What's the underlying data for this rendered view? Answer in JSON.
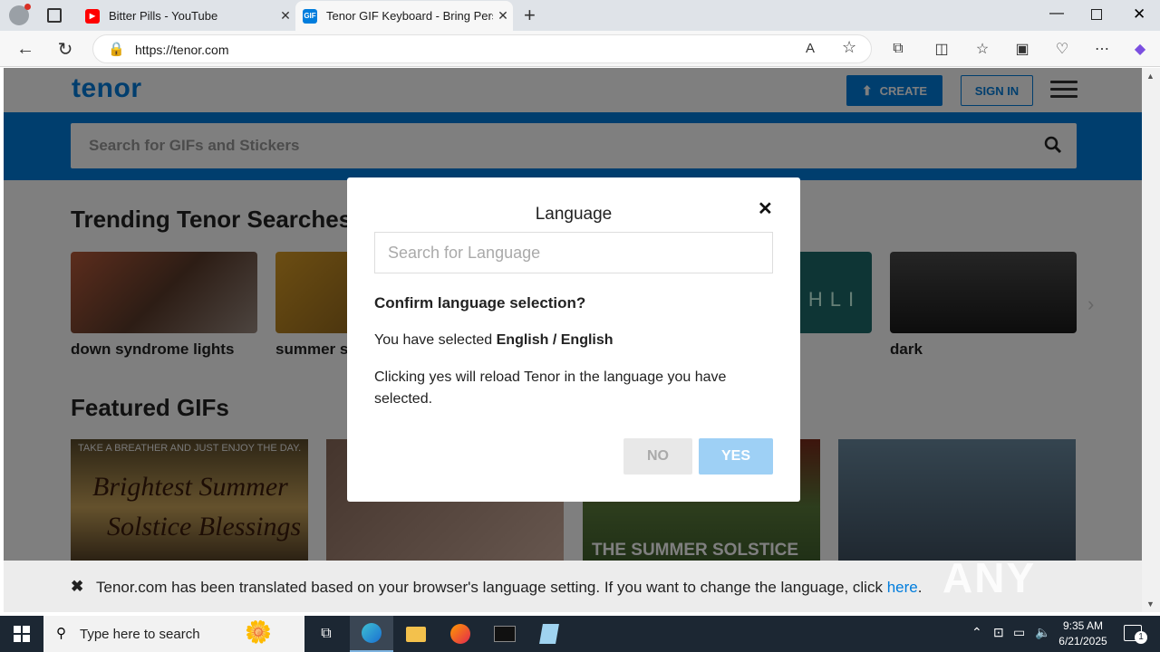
{
  "browser": {
    "tabs": [
      {
        "title": "Bitter Pills - YouTube",
        "favicon": "youtube-icon"
      },
      {
        "title": "Tenor GIF Keyboard - Bring Perso",
        "favicon": "gif-icon",
        "favicon_text": "GIF"
      }
    ],
    "url": "https://tenor.com"
  },
  "site": {
    "logo": "tenor",
    "create_label": "CREATE",
    "signin_label": "SIGN IN",
    "search_placeholder": "Search for GIFs and Stickers"
  },
  "trending": {
    "title": "Trending Tenor Searches",
    "items": [
      {
        "label": "down syndrome lights",
        "color": "#8a5a3c"
      },
      {
        "label": "summer so",
        "color": "#6b4a18"
      },
      {
        "label": "",
        "color": "#1c6b6b",
        "overlay_text": "CHLI"
      },
      {
        "label": "dark",
        "color": "#2e2e2e"
      }
    ]
  },
  "featured": {
    "title": "Featured GIFs",
    "gifs": [
      {
        "top_caption": "TAKE A BREATHER AND JUST ENJOY THE DAY.",
        "line1": "Brightest Summer",
        "line2": "Solstice Blessings"
      },
      {
        "caption": ""
      },
      {
        "caption": "THE SUMMER SOLSTICE"
      },
      {
        "caption": ""
      }
    ]
  },
  "modal": {
    "title": "Language",
    "search_placeholder": "Search for Language",
    "question": "Confirm language selection?",
    "selected_prefix": "You have selected ",
    "selected_value": "English / English",
    "note": "Clicking yes will reload Tenor in the language you have selected.",
    "no_label": "NO",
    "yes_label": "YES"
  },
  "banner": {
    "text": "Tenor.com has been translated based on your browser's language setting. If you want to change the language, click ",
    "link": "here",
    "end": "."
  },
  "watermark": "ANY RUN",
  "taskbar": {
    "search_placeholder": "Type here to search",
    "time": "9:35 AM",
    "date": "6/21/2025",
    "notification_count": "1"
  }
}
